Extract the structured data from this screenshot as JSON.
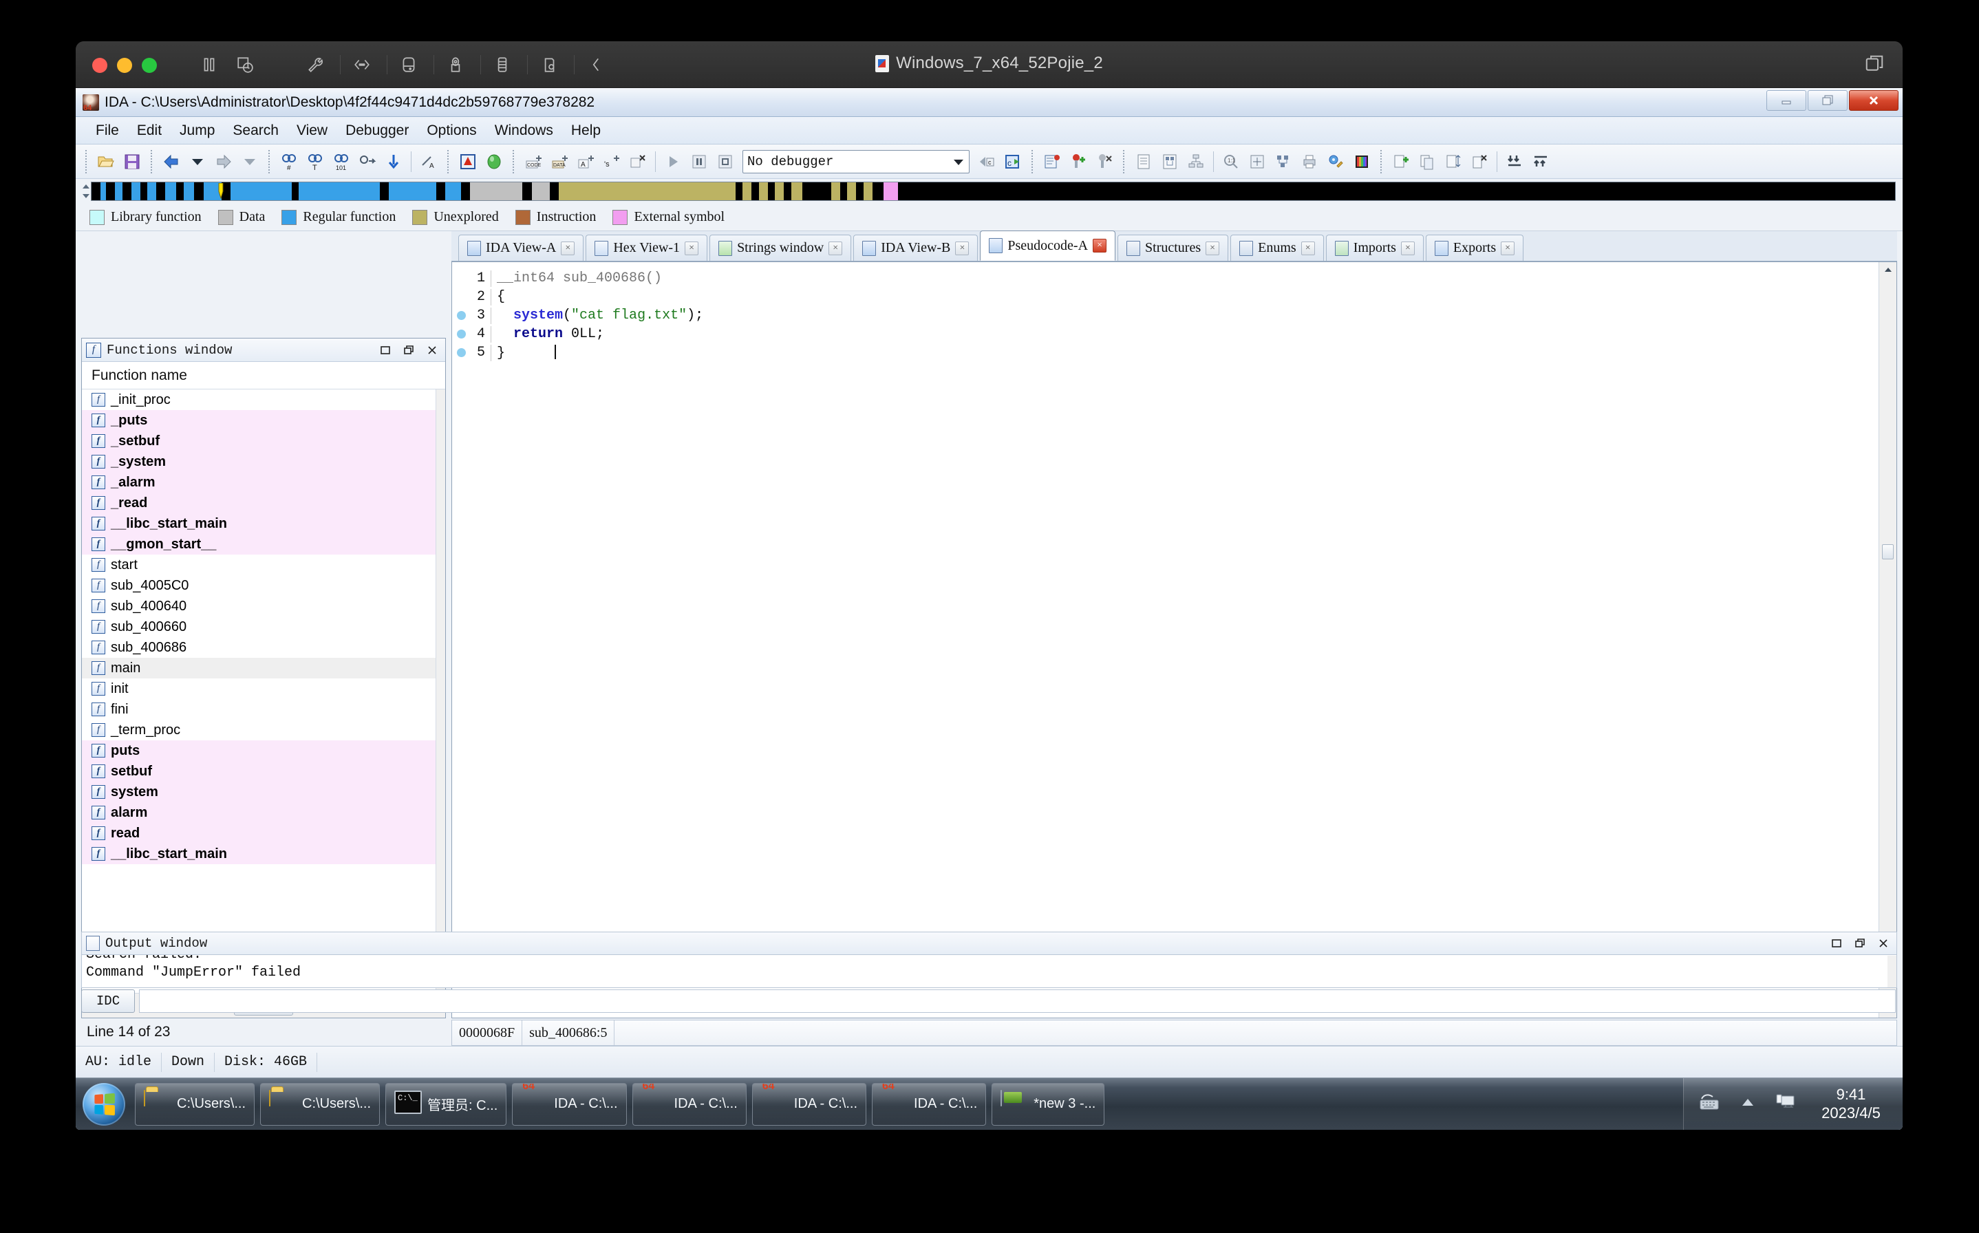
{
  "vm": {
    "title": "Windows_7_x64_52Pojie_2",
    "toolbar_icons": [
      "pause-icon",
      "snapshot-icon",
      "settings-wrench-icon",
      "network-icon",
      "harddisk-icon",
      "camera-icon",
      "usb-icon",
      "printer-icon",
      "collapse-chevron-icon"
    ],
    "traffic_lights": [
      "close-button",
      "minimize-button",
      "maximize-button"
    ],
    "right_icon": "unity-view-icon"
  },
  "ida": {
    "title": "IDA - C:\\Users\\Administrator\\Desktop\\4f2f44c9471d4dc2b59768779e378282",
    "window_buttons": [
      "minimize-button",
      "restore-button",
      "close-button"
    ],
    "menu": [
      "File",
      "Edit",
      "Jump",
      "Search",
      "View",
      "Debugger",
      "Options",
      "Windows",
      "Help"
    ],
    "debugger_select": "No debugger",
    "legend": [
      {
        "label": "Library function",
        "color": "#c6fafa"
      },
      {
        "label": "Data",
        "color": "#c0c0c0"
      },
      {
        "label": "Regular function",
        "color": "#38a1e8"
      },
      {
        "label": "Unexplored",
        "color": "#bcb363"
      },
      {
        "label": "Instruction",
        "color": "#b06838"
      },
      {
        "label": "External symbol",
        "color": "#f29ef0"
      }
    ],
    "navband_segments": [
      {
        "left": 0.5,
        "width": 0.3,
        "color": "#38a1e8"
      },
      {
        "left": 0.8,
        "width": 0.5,
        "color": "#000000"
      },
      {
        "left": 1.3,
        "width": 0.4,
        "color": "#38a1e8"
      },
      {
        "left": 1.7,
        "width": 0.5,
        "color": "#000000"
      },
      {
        "left": 2.2,
        "width": 0.5,
        "color": "#38a1e8"
      },
      {
        "left": 2.7,
        "width": 0.4,
        "color": "#000000"
      },
      {
        "left": 3.1,
        "width": 0.5,
        "color": "#38a1e8"
      },
      {
        "left": 3.6,
        "width": 0.5,
        "color": "#000000"
      },
      {
        "left": 4.1,
        "width": 0.6,
        "color": "#38a1e8"
      },
      {
        "left": 4.7,
        "width": 0.4,
        "color": "#000000"
      },
      {
        "left": 5.1,
        "width": 0.6,
        "color": "#38a1e8"
      },
      {
        "left": 5.7,
        "width": 0.5,
        "color": "#000000"
      },
      {
        "left": 6.2,
        "width": 1.0,
        "color": "#38a1e8"
      },
      {
        "left": 7.2,
        "width": 0.5,
        "color": "#000000"
      },
      {
        "left": 7.7,
        "width": 3.4,
        "color": "#38a1e8"
      },
      {
        "left": 11.1,
        "width": 0.4,
        "color": "#000000"
      },
      {
        "left": 11.5,
        "width": 4.5,
        "color": "#38a1e8"
      },
      {
        "left": 16.0,
        "width": 0.5,
        "color": "#000000"
      },
      {
        "left": 16.5,
        "width": 2.6,
        "color": "#38a1e8"
      },
      {
        "left": 19.1,
        "width": 0.5,
        "color": "#000000"
      },
      {
        "left": 19.6,
        "width": 0.9,
        "color": "#38a1e8"
      },
      {
        "left": 20.5,
        "width": 0.5,
        "color": "#000000"
      },
      {
        "left": 21.0,
        "width": 2.9,
        "color": "#c0c0c0"
      },
      {
        "left": 23.9,
        "width": 0.5,
        "color": "#000000"
      },
      {
        "left": 24.4,
        "width": 1.0,
        "color": "#c0c0c0"
      },
      {
        "left": 25.4,
        "width": 0.5,
        "color": "#000000"
      },
      {
        "left": 25.9,
        "width": 9.8,
        "color": "#bcb363"
      },
      {
        "left": 35.7,
        "width": 0.4,
        "color": "#000000"
      },
      {
        "left": 36.1,
        "width": 0.5,
        "color": "#bcb363"
      },
      {
        "left": 36.6,
        "width": 0.4,
        "color": "#000000"
      },
      {
        "left": 37.0,
        "width": 0.5,
        "color": "#bcb363"
      },
      {
        "left": 37.5,
        "width": 0.4,
        "color": "#000000"
      },
      {
        "left": 37.9,
        "width": 0.5,
        "color": "#bcb363"
      },
      {
        "left": 38.4,
        "width": 0.4,
        "color": "#000000"
      },
      {
        "left": 38.8,
        "width": 0.6,
        "color": "#bcb363"
      },
      {
        "left": 39.4,
        "width": 1.6,
        "color": "#000000"
      },
      {
        "left": 41.0,
        "width": 0.5,
        "color": "#bcb363"
      },
      {
        "left": 41.5,
        "width": 0.4,
        "color": "#000000"
      },
      {
        "left": 41.9,
        "width": 0.5,
        "color": "#bcb363"
      },
      {
        "left": 42.4,
        "width": 0.4,
        "color": "#000000"
      },
      {
        "left": 42.8,
        "width": 0.5,
        "color": "#bcb363"
      },
      {
        "left": 43.3,
        "width": 0.6,
        "color": "#000000"
      },
      {
        "left": 43.9,
        "width": 0.8,
        "color": "#f29ef0"
      },
      {
        "left": 44.7,
        "width": 55.3,
        "color": "#000000"
      }
    ],
    "navband_cursor_color": "#ffe200"
  },
  "functions_panel": {
    "title": "Functions window",
    "column_header": "Function name",
    "status": "Line 14 of 23",
    "panel_buttons": [
      "restore-panel-button",
      "float-panel-button",
      "close-panel-button"
    ],
    "items": [
      {
        "name": "_init_proc",
        "library": false,
        "selected": false
      },
      {
        "name": "_puts",
        "library": true,
        "selected": false
      },
      {
        "name": "_setbuf",
        "library": true,
        "selected": false
      },
      {
        "name": "_system",
        "library": true,
        "selected": false
      },
      {
        "name": "_alarm",
        "library": true,
        "selected": false
      },
      {
        "name": "_read",
        "library": true,
        "selected": false
      },
      {
        "name": "__libc_start_main",
        "library": true,
        "selected": false
      },
      {
        "name": "__gmon_start__",
        "library": true,
        "selected": false
      },
      {
        "name": "start",
        "library": false,
        "selected": false
      },
      {
        "name": "sub_4005C0",
        "library": false,
        "selected": false
      },
      {
        "name": "sub_400640",
        "library": false,
        "selected": false
      },
      {
        "name": "sub_400660",
        "library": false,
        "selected": false
      },
      {
        "name": "sub_400686",
        "library": false,
        "selected": false
      },
      {
        "name": "main",
        "library": false,
        "selected": true
      },
      {
        "name": "init",
        "library": false,
        "selected": false
      },
      {
        "name": "fini",
        "library": false,
        "selected": false
      },
      {
        "name": "_term_proc",
        "library": false,
        "selected": false
      },
      {
        "name": "puts",
        "library": true,
        "selected": false
      },
      {
        "name": "setbuf",
        "library": true,
        "selected": false
      },
      {
        "name": "system",
        "library": true,
        "selected": false
      },
      {
        "name": "alarm",
        "library": true,
        "selected": false
      },
      {
        "name": "read",
        "library": true,
        "selected": false
      },
      {
        "name": "__libc_start_main",
        "library": true,
        "selected": false
      }
    ]
  },
  "tabs": [
    {
      "label": "IDA View-A",
      "icon": "ida-view-icon",
      "active": false
    },
    {
      "label": "Hex View-1",
      "icon": "hex-view-icon",
      "active": false
    },
    {
      "label": "Strings window",
      "icon": "strings-icon",
      "active": false
    },
    {
      "label": "IDA View-B",
      "icon": "ida-view-icon",
      "active": false
    },
    {
      "label": "Pseudocode-A",
      "icon": "pseudocode-icon",
      "active": true
    },
    {
      "label": "Structures",
      "icon": "structures-icon",
      "active": false
    },
    {
      "label": "Enums",
      "icon": "enums-icon",
      "active": false
    },
    {
      "label": "Imports",
      "icon": "imports-icon",
      "active": false
    },
    {
      "label": "Exports",
      "icon": "exports-icon",
      "active": false
    }
  ],
  "pseudocode": {
    "lines": [
      {
        "num": "1",
        "breakpoint": false,
        "tokens": [
          {
            "t": "__int64 ",
            "c": "k-type"
          },
          {
            "t": "sub_400686()",
            "c": "k-type"
          }
        ]
      },
      {
        "num": "2",
        "breakpoint": false,
        "tokens": [
          {
            "t": "{",
            "c": "k-plain"
          }
        ]
      },
      {
        "num": "3",
        "breakpoint": true,
        "tokens": [
          {
            "t": "  ",
            "c": "k-plain"
          },
          {
            "t": "system",
            "c": "k-fn"
          },
          {
            "t": "(",
            "c": "k-plain"
          },
          {
            "t": "\"cat flag.txt\"",
            "c": "k-str"
          },
          {
            "t": ");",
            "c": "k-plain"
          }
        ]
      },
      {
        "num": "4",
        "breakpoint": true,
        "tokens": [
          {
            "t": "  ",
            "c": "k-plain"
          },
          {
            "t": "return",
            "c": "k-kw"
          },
          {
            "t": " 0LL;",
            "c": "k-plain"
          }
        ]
      },
      {
        "num": "5",
        "breakpoint": true,
        "tokens": [
          {
            "t": "}",
            "c": "k-plain"
          }
        ]
      }
    ],
    "status_address": "0000068F",
    "status_location": "sub_400686:5"
  },
  "output_window": {
    "title": "Output window",
    "lines": [
      "Search failed.",
      "Command \"JumpError\" failed"
    ],
    "idc_button": "IDC",
    "input_value": ""
  },
  "ida_statusbar": {
    "au": "AU: idle",
    "state": "Down",
    "disk": "Disk: 46GB"
  },
  "taskbar": {
    "start_button": "start-orb",
    "tasks": [
      {
        "label": "C:\\Users\\...",
        "icon": "folder-icon"
      },
      {
        "label": "C:\\Users\\...",
        "icon": "folder-icon"
      },
      {
        "label": "管理员: C...",
        "icon": "command-prompt-icon"
      },
      {
        "label": "IDA - C:\\...",
        "icon": "ida-icon"
      },
      {
        "label": "IDA - C:\\...",
        "icon": "ida-icon"
      },
      {
        "label": "IDA - C:\\...",
        "icon": "ida-icon"
      },
      {
        "label": "IDA - C:\\...",
        "icon": "ida-icon"
      },
      {
        "label": "*new 3 -...",
        "icon": "notepad-icon"
      }
    ],
    "tray_icons": [
      "keyboard-icon",
      "show-hidden-icons-icon",
      "network-monitor-icon"
    ],
    "time": "9:41",
    "date": "2023/4/5"
  }
}
